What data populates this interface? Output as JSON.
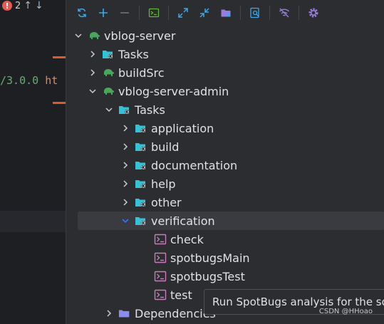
{
  "editor": {
    "error_count": "2",
    "code_fragment_a": "/3.0.0",
    "code_fragment_b": "ht"
  },
  "toolbar": {
    "buttons": [
      "reload-icon",
      "add-icon",
      "remove-icon",
      "terminal-icon",
      "expand-all-icon",
      "collapse-all-icon",
      "folder-icon",
      "analyze-icon",
      "toggle-offline-icon",
      "settings-icon"
    ]
  },
  "tree": {
    "items": [
      {
        "label": "vblog-server"
      },
      {
        "label": "Tasks"
      },
      {
        "label": "buildSrc"
      },
      {
        "label": "vblog-server-admin"
      },
      {
        "label": "Tasks"
      },
      {
        "label": "application"
      },
      {
        "label": "build"
      },
      {
        "label": "documentation"
      },
      {
        "label": "help"
      },
      {
        "label": "other"
      },
      {
        "label": "verification"
      },
      {
        "label": "check"
      },
      {
        "label": "spotbugsMain"
      },
      {
        "label": "spotbugsTest"
      },
      {
        "label": "test"
      },
      {
        "label": "Dependencies"
      }
    ]
  },
  "tooltip": {
    "text": "Run SpotBugs analysis for the sou"
  },
  "watermark": "CSDN @HHoao",
  "colors": {
    "accent": "#3574f0",
    "folder": "#36c2d6",
    "gradle": "#4aa65a",
    "task": "#c77dbb",
    "error": "#e55b54"
  }
}
